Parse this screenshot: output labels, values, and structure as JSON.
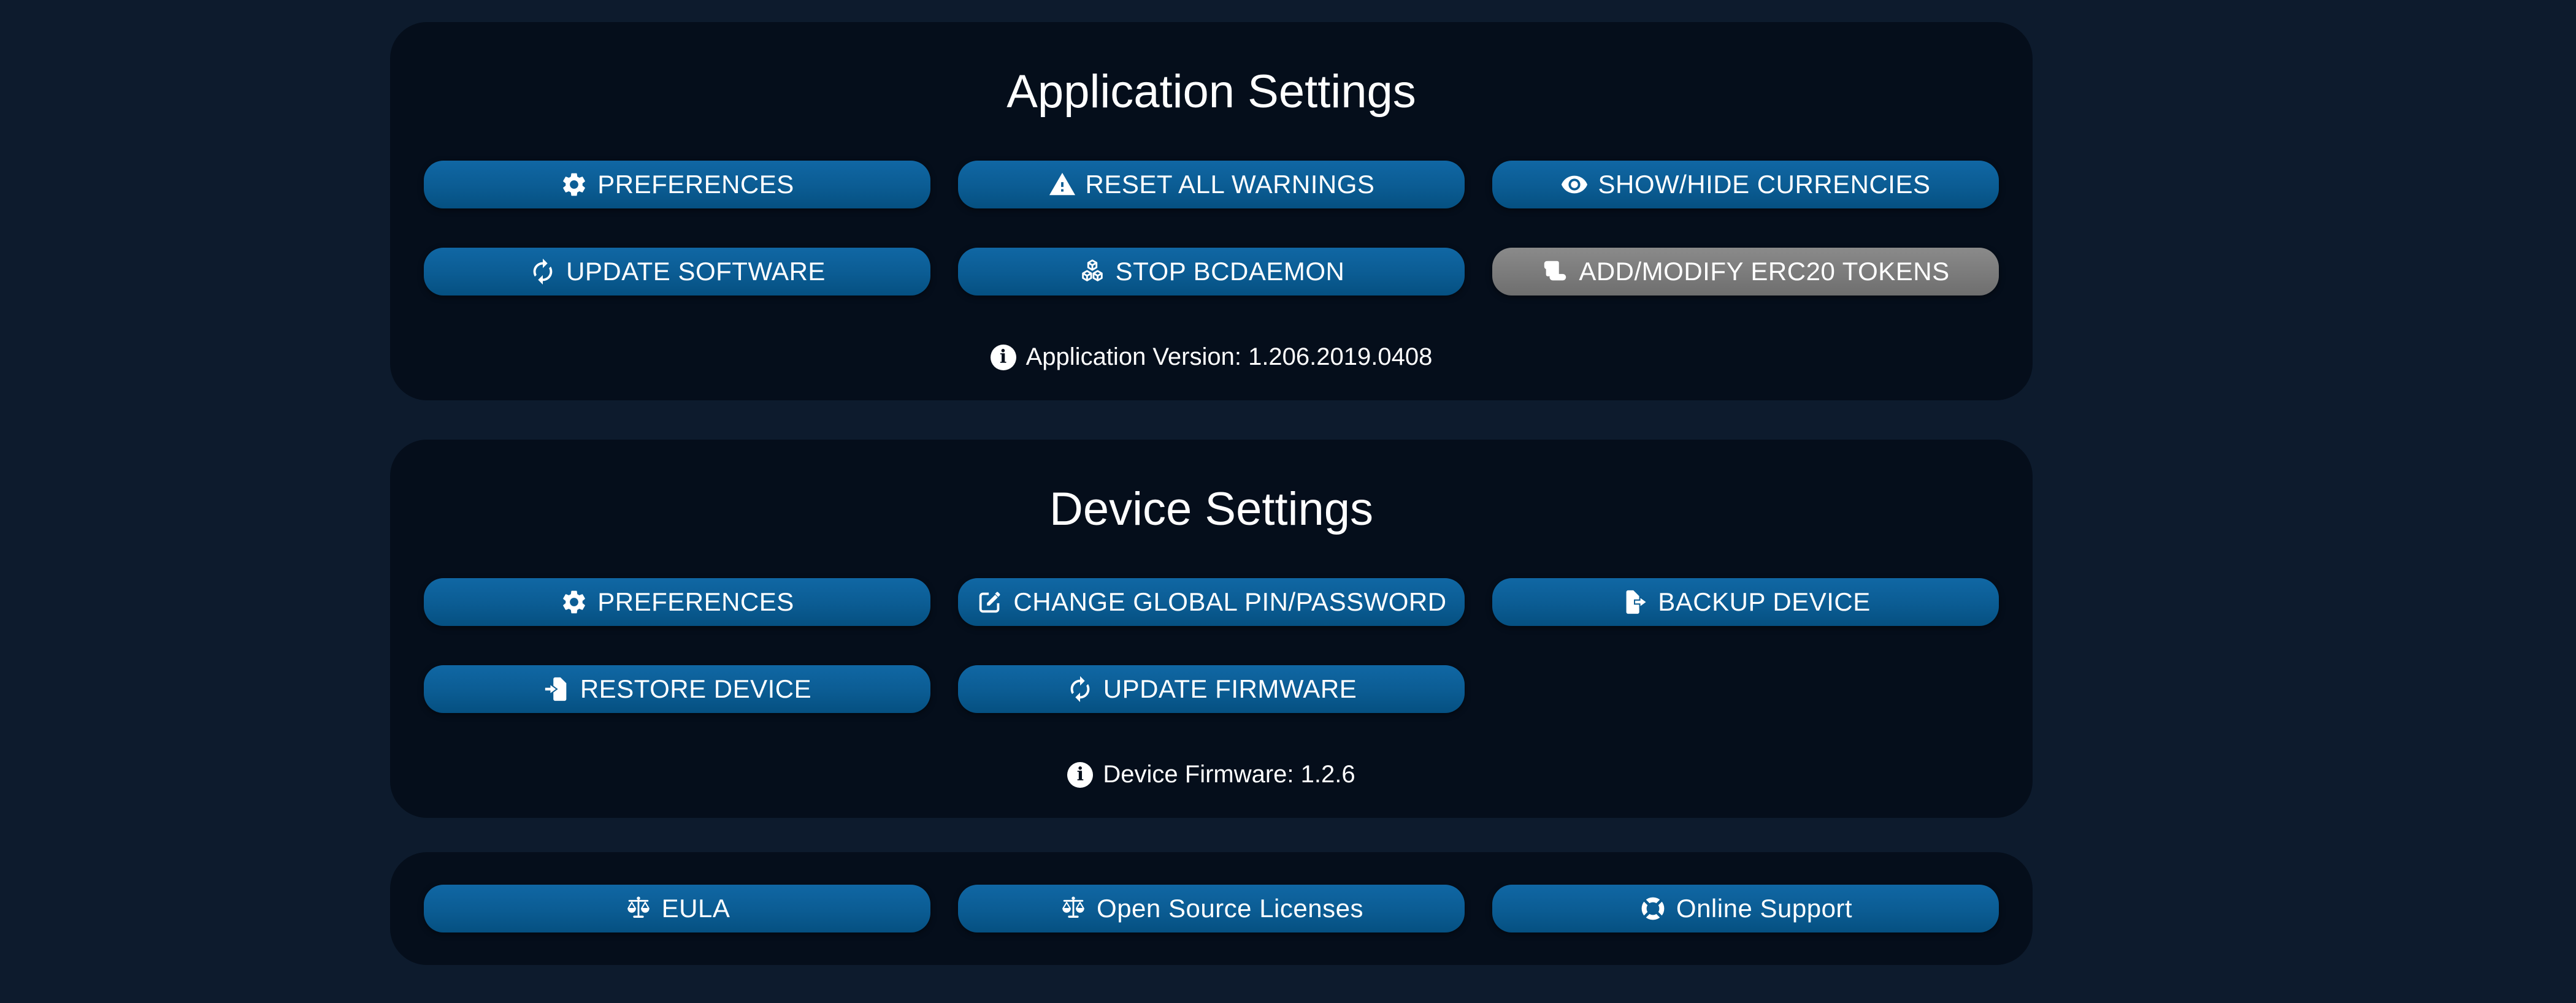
{
  "colors": {
    "page_background": "#0d1b2d",
    "card_background": "#050e1b",
    "button_blue_top": "#1067a4",
    "button_blue_bottom": "#055081",
    "button_gray": "#7d7d7d",
    "text": "#ffffff"
  },
  "application_settings": {
    "title": "Application Settings",
    "buttons": [
      {
        "label": "PREFERENCES",
        "icon": "gear-icon",
        "style": "blue"
      },
      {
        "label": "RESET ALL WARNINGS",
        "icon": "warning-icon",
        "style": "blue"
      },
      {
        "label": "SHOW/HIDE CURRENCIES",
        "icon": "eye-icon",
        "style": "blue"
      },
      {
        "label": "UPDATE SOFTWARE",
        "icon": "sync-icon",
        "style": "blue"
      },
      {
        "label": "STOP BCDAEMON",
        "icon": "cubes-icon",
        "style": "blue"
      },
      {
        "label": "ADD/MODIFY ERC20 TOKENS",
        "icon": "scroll-icon",
        "style": "gray"
      }
    ],
    "version_note": {
      "icon": "info-icon",
      "text": "Application Version: 1.206.2019.0408"
    }
  },
  "device_settings": {
    "title": "Device Settings",
    "buttons": [
      {
        "label": "PREFERENCES",
        "icon": "gear-icon",
        "style": "blue"
      },
      {
        "label": "CHANGE GLOBAL PIN/PASSWORD",
        "icon": "edit-icon",
        "style": "blue"
      },
      {
        "label": "BACKUP DEVICE",
        "icon": "file-export-icon",
        "style": "blue"
      },
      {
        "label": "RESTORE DEVICE",
        "icon": "file-import-icon",
        "style": "blue"
      },
      {
        "label": "UPDATE FIRMWARE",
        "icon": "sync-icon",
        "style": "blue"
      }
    ],
    "firmware_note": {
      "icon": "info-icon",
      "text": "Device Firmware: 1.2.6"
    }
  },
  "legal_support": {
    "buttons": [
      {
        "label": "EULA",
        "icon": "balance-scale-icon",
        "style": "blue"
      },
      {
        "label": "Open Source Licenses",
        "icon": "balance-scale-icon",
        "style": "blue"
      },
      {
        "label": "Online Support",
        "icon": "life-ring-icon",
        "style": "blue"
      }
    ]
  }
}
